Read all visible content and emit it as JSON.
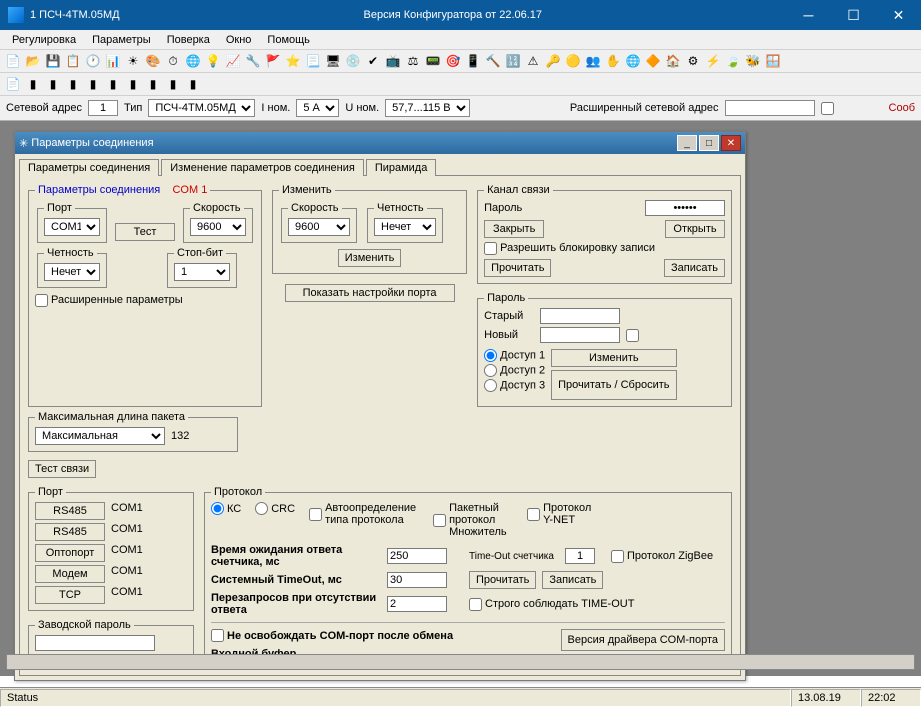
{
  "titlebar": {
    "title": "1  ПСЧ-4ТМ.05МД",
    "center": "Версия Конфигуратора  от 22.06.17"
  },
  "menu": {
    "reg": "Регулировка",
    "params": "Параметры",
    "check": "Поверка",
    "window": "Окно",
    "help": "Помощь"
  },
  "parambar": {
    "net_addr_label": "Сетевой адрес",
    "net_addr": "1",
    "type_label": "Тип",
    "type": "ПСЧ-4ТМ.05МД",
    "inom_label": "I ном.",
    "inom": "5 А",
    "unom_label": "U ном.",
    "unom": "57,7...115 В",
    "ext_addr_label": "Расширенный сетевой адрес",
    "ext_addr": "",
    "soob": "Сооб"
  },
  "child": {
    "title": "Параметры соединения",
    "tabs": {
      "t1": "Параметры соединения",
      "t2": "Изменение параметров соединения",
      "t3": "Пирамида"
    },
    "conn": {
      "legend": "Параметры соединения",
      "com": "COM 1",
      "port_label": "Порт",
      "port": "COM1",
      "speed_label": "Скорость",
      "speed": "9600",
      "parity_label": "Четность",
      "parity": "Нечет",
      "stop_label": "Стоп-бит",
      "stop": "1",
      "test": "Тест",
      "ext_params": "Расширенные параметры"
    },
    "change": {
      "legend": "Изменить",
      "speed_label": "Скорость",
      "speed": "9600",
      "parity_label": "Четность",
      "parity": "Нечет",
      "btn": "Изменить",
      "show_port": "Показать настройки порта"
    },
    "maxlen": {
      "legend": "Максимальная длина пакета",
      "value": "Максимальная",
      "num": "132"
    },
    "channel": {
      "legend": "Канал связи",
      "pwd": "Пароль",
      "close": "Закрыть",
      "open": "Открыть",
      "allow_block": "Разрешить блокировку записи",
      "read": "Прочитать",
      "write": "Записать"
    },
    "password": {
      "legend": "Пароль",
      "old": "Старый",
      "new": "Новый",
      "a1": "Доступ 1",
      "a2": "Доступ 2",
      "a3": "Доступ 3",
      "change": "Изменить",
      "read_reset": "Прочитать / Сбросить"
    },
    "test_link": "Тест связи",
    "port": {
      "legend": "Порт",
      "rs485": "RS485",
      "opto": "Оптопорт",
      "modem": "Модем",
      "tcp": "TCP",
      "com1": "COM1"
    },
    "factory_pwd": "Заводской пароль",
    "proto": {
      "legend": "Протокол",
      "kc": "КС",
      "crc": "CRC",
      "auto": "Автоопределение типа протокола",
      "packet": "Пакетный протокол Множитель",
      "ynet": "Протокол Y-NET",
      "timeout_meter": "Time-Out счетчика",
      "timeout_val": "1",
      "zigbee": "Протокол ZigBee",
      "wait": "Время ожидания ответа счетчика, мс",
      "wait_val": "250",
      "systo": "Системный TimeOut, мс",
      "systo_val": "30",
      "retry": "Перезапросов при отсутствии ответа",
      "retry_val": "2",
      "read": "Прочитать",
      "write": "Записать",
      "strict": "Строго соблюдать TIME-OUT",
      "nofree": "Не освобождать COM-порт после обмена",
      "inbuf": "Входной буфер",
      "drv_ver": "Версия драйвера COM-порта"
    }
  },
  "status": {
    "label": "Status",
    "date": "13.08.19",
    "time": "22:02"
  }
}
